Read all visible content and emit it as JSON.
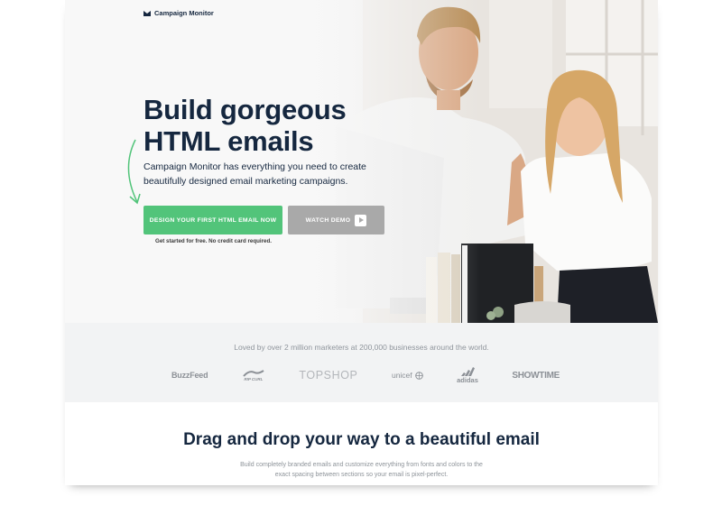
{
  "header": {
    "brand": "Campaign Monitor"
  },
  "hero": {
    "headline_line1": "Build gorgeous",
    "headline_line2": "HTML emails",
    "subtext_line1": "Campaign Monitor has everything you need to create",
    "subtext_line2": "beautifully designed email marketing campaigns.",
    "cta_label": "DESIGN YOUR FIRST HTML EMAIL NOW",
    "demo_label": "WATCH DEMO",
    "free_note": "Get started for free. No credit card required."
  },
  "social_proof": {
    "tagline": "Loved by over 2 million marketers at 200,000 businesses around the world.",
    "brands": [
      {
        "name": "BuzzFeed"
      },
      {
        "name": "RIP CURL"
      },
      {
        "name": "TOPSHOP"
      },
      {
        "name": "unicef"
      },
      {
        "name": "adidas"
      },
      {
        "name": "SHOWTIME"
      }
    ]
  },
  "feature": {
    "title": "Drag and drop your way to a beautiful email",
    "body_line1": "Build completely branded emails and customize everything from fonts and colors to the",
    "body_line2": "exact spacing between sections so your email is pixel-perfect."
  },
  "colors": {
    "primary_text": "#15273f",
    "cta_green": "#52c47a",
    "demo_gray": "#a9a9a9",
    "band_bg": "#f2f3f4"
  },
  "icons": [
    "logo-mark-icon",
    "curved-arrow-icon",
    "play-icon",
    "unicef-globe-icon",
    "adidas-stripes-icon",
    "ripcurl-wave-icon"
  ]
}
